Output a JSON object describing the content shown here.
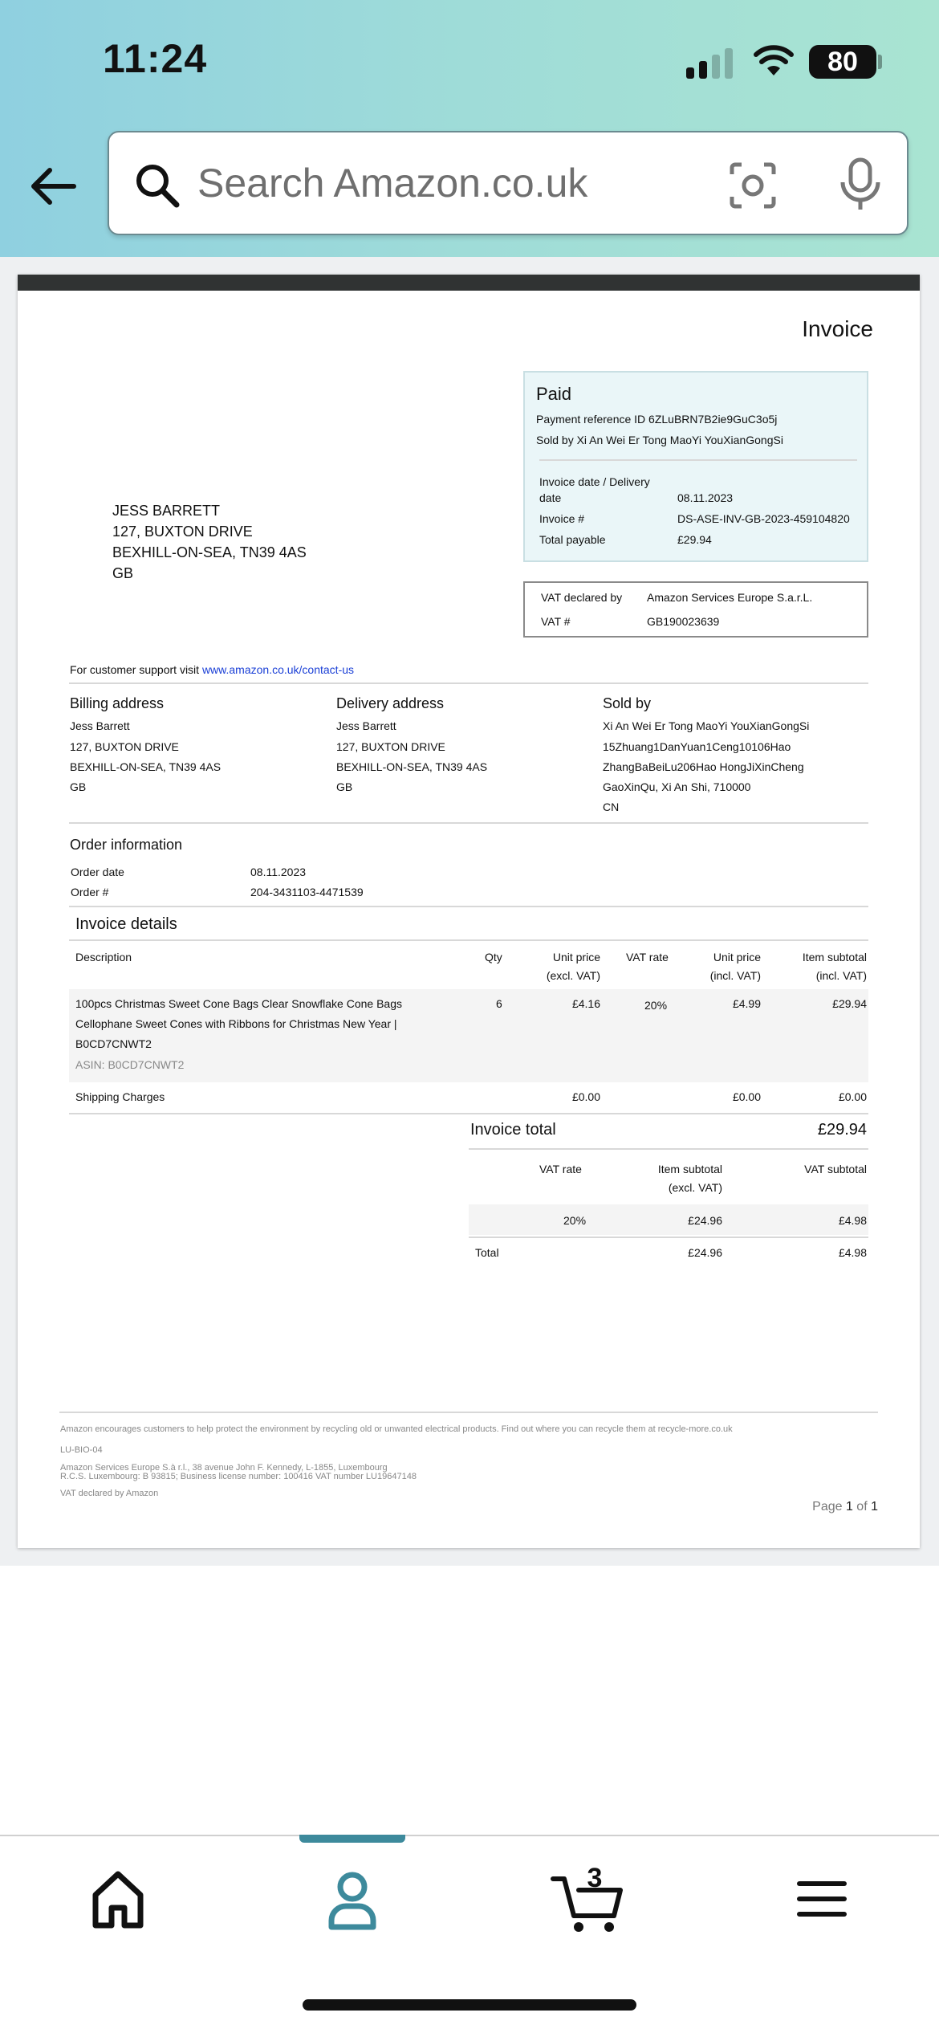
{
  "status_bar": {
    "time": "11:24",
    "battery": "80"
  },
  "search": {
    "placeholder": "Search Amazon.co.uk"
  },
  "invoice": {
    "title": "Invoice",
    "customer": {
      "name": "JESS BARRETT",
      "line1": "127, BUXTON DRIVE",
      "line2": "BEXHILL-ON-SEA, TN39 4AS",
      "country": "GB"
    },
    "paid_box": {
      "status": "Paid",
      "payment_ref": "Payment reference ID 6ZLuBRN7B2ie9GuC3o5j",
      "sold_by": "Sold by Xi An Wei Er Tong MaoYi YouXianGongSi",
      "rows": [
        {
          "label": "Invoice date / Delivery",
          "label2": "date",
          "value": "08.11.2023"
        },
        {
          "label": "Invoice #",
          "value": "DS-ASE-INV-GB-2023-459104820"
        },
        {
          "label": "Total payable",
          "value": "£29.94"
        }
      ]
    },
    "vat_box": {
      "declared_label": "VAT declared by",
      "declared_value": "Amazon Services Europe S.a.r.L.",
      "vat_label": "VAT #",
      "vat_value": "GB190023639"
    },
    "support": {
      "text": "For customer support visit ",
      "link": "www.amazon.co.uk/contact-us"
    },
    "billing": {
      "heading": "Billing address",
      "lines": [
        "Jess Barrett",
        "127, BUXTON DRIVE",
        "BEXHILL-ON-SEA, TN39 4AS",
        "GB"
      ]
    },
    "delivery": {
      "heading": "Delivery address",
      "lines": [
        "Jess Barrett",
        "127, BUXTON DRIVE",
        "BEXHILL-ON-SEA, TN39 4AS",
        "GB"
      ]
    },
    "seller": {
      "heading": "Sold by",
      "lines": [
        "Xi An Wei Er Tong MaoYi YouXianGongSi",
        "15Zhuang1DanYuan1Ceng10106Hao",
        "ZhangBaBeiLu206Hao HongJiXinCheng",
        "GaoXinQu, Xi An Shi, 710000",
        "CN"
      ]
    },
    "order_info": {
      "heading": "Order information",
      "date_label": "Order date",
      "date_value": "08.11.2023",
      "number_label": "Order #",
      "number_value": "204-3431103-4471539"
    },
    "details": {
      "heading": "Invoice details",
      "columns": {
        "description": "Description",
        "qty": "Qty",
        "unit_excl_1": "Unit price",
        "unit_excl_2": "(excl. VAT)",
        "vat_rate": "VAT rate",
        "unit_incl_1": "Unit price",
        "unit_incl_2": "(incl. VAT)",
        "subtotal_1": "Item subtotal",
        "subtotal_2": "(incl. VAT)"
      },
      "item": {
        "desc_1": "100pcs Christmas Sweet Cone Bags Clear Snowflake Cone Bags",
        "desc_2": "Cellophane Sweet Cones with Ribbons for Christmas New Year |",
        "desc_3": "B0CD7CNWT2",
        "asin": "ASIN: B0CD7CNWT2",
        "qty": "6",
        "unit_excl": "£4.16",
        "vat_rate": "20%",
        "unit_incl": "£4.99",
        "subtotal": "£29.94"
      },
      "shipping": {
        "label": "Shipping Charges",
        "unit_excl": "£0.00",
        "unit_incl": "£0.00",
        "subtotal": "£0.00"
      }
    },
    "totals": {
      "label": "Invoice total",
      "value": "£29.94",
      "columns": {
        "vat_rate": "VAT rate",
        "item_subtotal_1": "Item subtotal",
        "item_subtotal_2": "(excl. VAT)",
        "vat_subtotal": "VAT subtotal"
      },
      "row": {
        "rate": "20%",
        "item_subtotal": "£24.96",
        "vat_subtotal": "£4.98"
      },
      "total_row": {
        "label": "Total",
        "item_subtotal": "£24.96",
        "vat_subtotal": "£4.98"
      }
    },
    "footer": {
      "recycle": "Amazon encourages customers to help protect the environment by recycling old or unwanted electrical products. Find out where you can recycle them at recycle-more.co.uk",
      "code": "LU-BIO-04",
      "company_1": "Amazon Services Europe S.à r.l., 38 avenue John F. Kennedy, L-1855, Luxembourg",
      "company_2": "R.C.S. Luxembourg: B 93815; Business license number: 100416 VAT number LU19647148",
      "declared": "VAT declared by Amazon",
      "page_prefix": "Page ",
      "page_current": "1",
      "page_of": " of ",
      "page_total": "1"
    }
  },
  "tabbar": {
    "cart_count": "3",
    "active_tab": "account",
    "accent_color": "#3d8a9c"
  }
}
